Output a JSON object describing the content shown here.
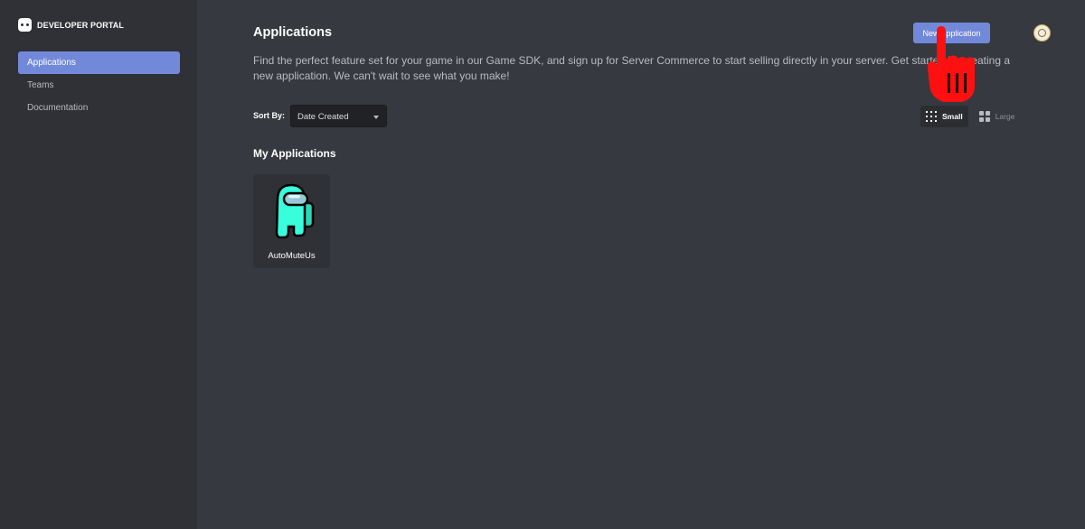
{
  "brand": {
    "title": "DEVELOPER PORTAL",
    "icon": "discord-logo-icon"
  },
  "sidebar": {
    "items": [
      {
        "label": "Applications",
        "active": true
      },
      {
        "label": "Teams",
        "active": false
      },
      {
        "label": "Documentation",
        "active": false
      }
    ]
  },
  "header": {
    "title": "Applications",
    "new_button_label": "New Application",
    "description": "Find the perfect feature set for your game in our Game SDK, and sign up for Server Commerce to start selling directly in your server. Get started by creating a new application. We can't wait to see what you make!"
  },
  "sort": {
    "label": "Sort By:",
    "value": "Date Created"
  },
  "view": {
    "options": [
      {
        "label": "Small",
        "active": true,
        "icon": "grid-small-icon"
      },
      {
        "label": "Large",
        "active": false,
        "icon": "grid-large-icon"
      }
    ]
  },
  "section": {
    "title": "My Applications"
  },
  "applications": [
    {
      "name": "AutoMuteUs",
      "icon": "crewmate-icon",
      "color": "#38fedc"
    }
  ],
  "colors": {
    "accent": "#7289da",
    "sidebar_bg": "#2f3136",
    "main_bg": "#36393f",
    "cursor": "#ff0000"
  }
}
